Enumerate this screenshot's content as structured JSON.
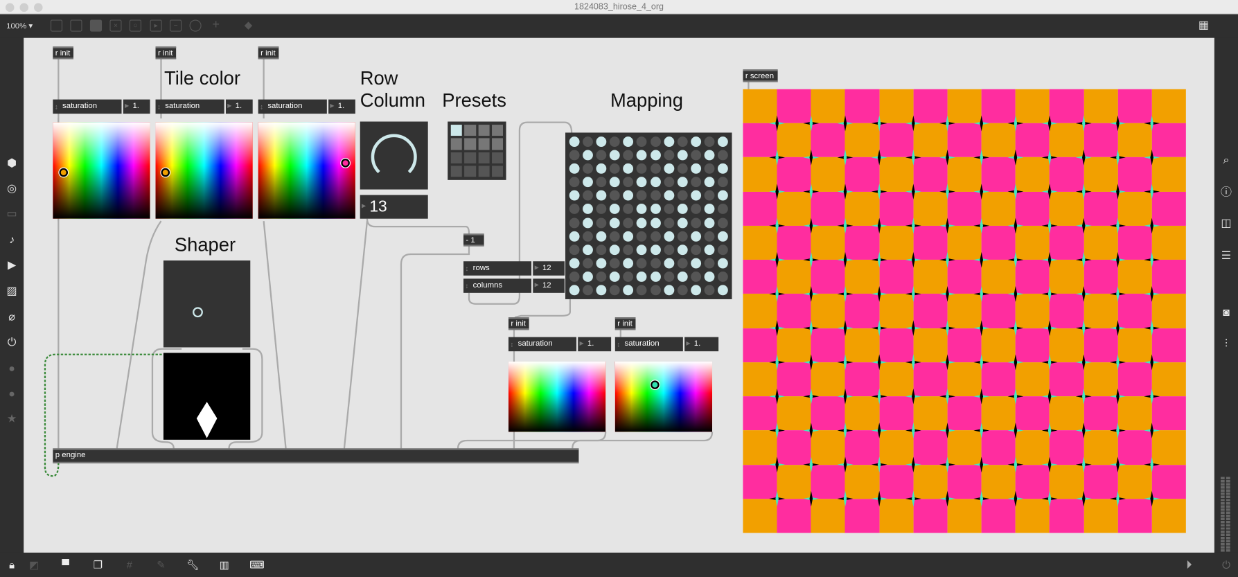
{
  "window": {
    "title": "1824083_hirose_4_org",
    "zoom": "100%"
  },
  "toolbar_icons": [
    "presentation-icon",
    "bpatcher-icon",
    "comment-icon",
    "toggle-icon",
    "button-icon",
    "play-icon",
    "slider-icon",
    "dial-icon",
    "plus-icon",
    "paint-bucket-icon"
  ],
  "labels": {
    "tile_color": "Tile color",
    "row": "Row",
    "column": "Column",
    "presets": "Presets",
    "mapping": "Mapping",
    "shaper": "Shaper"
  },
  "objects": {
    "r_init": "r init",
    "r_screen": "r screen",
    "minus_one": "- 1",
    "p_engine": "p engine"
  },
  "tile_pickers": [
    {
      "menu": "saturation",
      "value": "1.",
      "dot_color": "#f2a000"
    },
    {
      "menu": "saturation",
      "value": "1.",
      "dot_color": "#f2a000"
    },
    {
      "menu": "saturation",
      "value": "1.",
      "dot_color": "#ff2d9f"
    }
  ],
  "bottom_pickers": [
    {
      "menu": "saturation",
      "value": "1."
    },
    {
      "menu": "saturation",
      "value": "1.",
      "dot_color": "#33e0b0"
    }
  ],
  "row_column": {
    "value": "13"
  },
  "grid_size": {
    "rows_label": "rows",
    "rows": "12",
    "columns_label": "columns",
    "columns": "12"
  },
  "presets": {
    "selected": 0,
    "count": 16
  },
  "mapping": [
    [
      1,
      0,
      1,
      0,
      1,
      0,
      0,
      1,
      0,
      1,
      0,
      1
    ],
    [
      0,
      1,
      0,
      1,
      0,
      1,
      1,
      0,
      1,
      0,
      1,
      0
    ],
    [
      1,
      0,
      1,
      0,
      1,
      0,
      0,
      1,
      0,
      1,
      0,
      1
    ],
    [
      0,
      1,
      0,
      1,
      0,
      1,
      1,
      0,
      1,
      0,
      1,
      0
    ],
    [
      1,
      0,
      1,
      0,
      1,
      0,
      0,
      1,
      0,
      1,
      0,
      1
    ],
    [
      0,
      1,
      0,
      1,
      0,
      1,
      1,
      0,
      1,
      0,
      1,
      0
    ],
    [
      0,
      1,
      0,
      1,
      0,
      1,
      1,
      0,
      1,
      0,
      1,
      0
    ],
    [
      1,
      0,
      1,
      0,
      1,
      0,
      0,
      1,
      0,
      1,
      0,
      1
    ],
    [
      0,
      1,
      0,
      1,
      0,
      1,
      1,
      0,
      1,
      0,
      1,
      0
    ],
    [
      1,
      0,
      1,
      0,
      1,
      0,
      0,
      1,
      0,
      1,
      0,
      1
    ],
    [
      0,
      1,
      0,
      1,
      0,
      1,
      1,
      0,
      1,
      0,
      1,
      0
    ],
    [
      1,
      0,
      1,
      0,
      1,
      0,
      0,
      1,
      0,
      1,
      0,
      1
    ]
  ],
  "screen": {
    "tiles": 13,
    "color_a": "#f2a000",
    "color_b": "#ff2d9f",
    "star_a": "#000000",
    "star_b": "#44e8c0"
  },
  "colors": {
    "cell_on": "#cde8ea",
    "cell_off": "#555555"
  }
}
